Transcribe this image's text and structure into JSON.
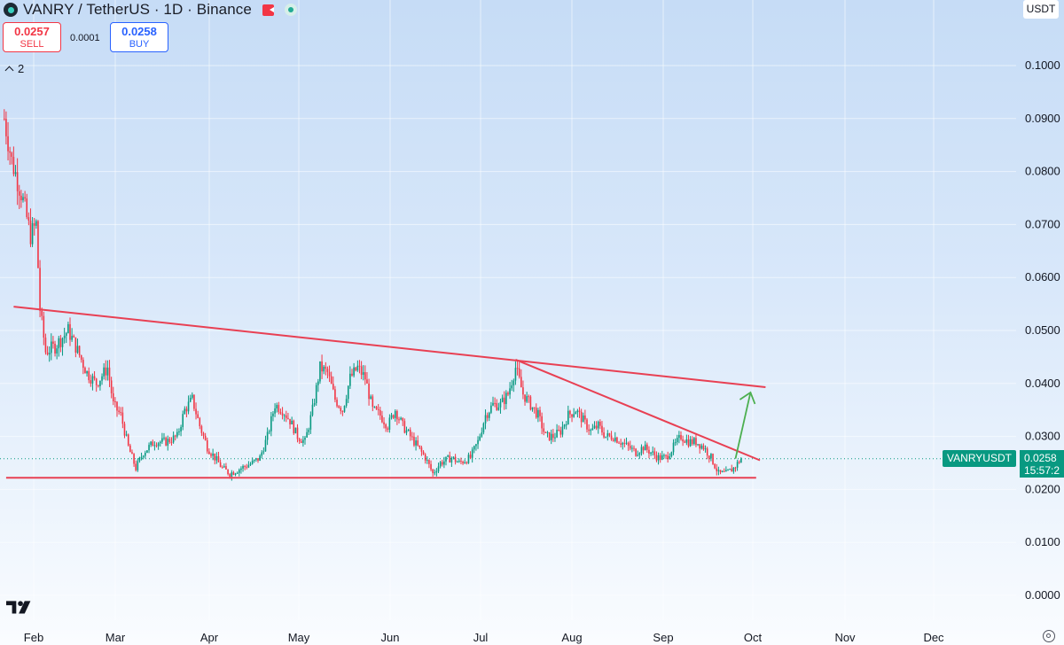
{
  "header": {
    "title": "VANRY / TetherUS · 1D · Binance",
    "sell_price": "0.0257",
    "sell_label": "SELL",
    "buy_price": "0.0258",
    "buy_label": "BUY",
    "spread": "0.0001",
    "indicators_count": "2",
    "icons": [
      "vanry-logo-icon",
      "flag-icon",
      "market-status-icon",
      "chevron-up-icon",
      "tradingview-logo-icon",
      "settings-icon"
    ]
  },
  "price_axis": {
    "currency": "USDT",
    "symbol_tag": "VANRYUSDT",
    "last_price": "0.0258",
    "countdown": "15:57:2"
  },
  "colors": {
    "up": "#089981",
    "down": "#f23645",
    "trendline": "#e84053",
    "arrow": "#4caf50"
  },
  "chart_data": {
    "type": "candlestick",
    "y_ticks": [
      "0.1000",
      "0.0900",
      "0.0800",
      "0.0700",
      "0.0600",
      "0.0500",
      "0.0400",
      "0.0300",
      "0.0200",
      "0.0100",
      "0.0000"
    ],
    "ylim": [
      0.0,
      0.1
    ],
    "x_ticks": [
      "Feb",
      "Mar",
      "Apr",
      "May",
      "Jun",
      "Jul",
      "Aug",
      "Sep",
      "Oct",
      "Nov",
      "Dec"
    ],
    "last_price": 0.0258,
    "price_path": [
      [
        0,
        0.09
      ],
      [
        4,
        0.082
      ],
      [
        9,
        0.076
      ],
      [
        14,
        0.068
      ],
      [
        17,
        0.07
      ],
      [
        19,
        0.054
      ],
      [
        22,
        0.046
      ],
      [
        27,
        0.047
      ],
      [
        34,
        0.05
      ],
      [
        38,
        0.047
      ],
      [
        44,
        0.042
      ],
      [
        49,
        0.04
      ],
      [
        55,
        0.043
      ],
      [
        58,
        0.036
      ],
      [
        62,
        0.034
      ],
      [
        66,
        0.028
      ],
      [
        70,
        0.024
      ],
      [
        74,
        0.027
      ],
      [
        80,
        0.029
      ],
      [
        86,
        0.029
      ],
      [
        92,
        0.03
      ],
      [
        96,
        0.035
      ],
      [
        100,
        0.037
      ],
      [
        104,
        0.032
      ],
      [
        108,
        0.028
      ],
      [
        112,
        0.026
      ],
      [
        116,
        0.024
      ],
      [
        120,
        0.023
      ],
      [
        126,
        0.024
      ],
      [
        132,
        0.025
      ],
      [
        136,
        0.026
      ],
      [
        140,
        0.03
      ],
      [
        144,
        0.036
      ],
      [
        148,
        0.035
      ],
      [
        152,
        0.033
      ],
      [
        156,
        0.03
      ],
      [
        160,
        0.029
      ],
      [
        164,
        0.035
      ],
      [
        168,
        0.043
      ],
      [
        172,
        0.042
      ],
      [
        176,
        0.037
      ],
      [
        180,
        0.035
      ],
      [
        184,
        0.041
      ],
      [
        188,
        0.043
      ],
      [
        192,
        0.041
      ],
      [
        196,
        0.035
      ],
      [
        200,
        0.034
      ],
      [
        204,
        0.032
      ],
      [
        208,
        0.035
      ],
      [
        212,
        0.032
      ],
      [
        216,
        0.03
      ],
      [
        220,
        0.028
      ],
      [
        224,
        0.026
      ],
      [
        228,
        0.023
      ],
      [
        232,
        0.025
      ],
      [
        238,
        0.026
      ],
      [
        242,
        0.025
      ],
      [
        248,
        0.026
      ],
      [
        252,
        0.029
      ],
      [
        256,
        0.034
      ],
      [
        260,
        0.036
      ],
      [
        264,
        0.036
      ],
      [
        268,
        0.038
      ],
      [
        272,
        0.043
      ],
      [
        276,
        0.038
      ],
      [
        280,
        0.036
      ],
      [
        284,
        0.034
      ],
      [
        288,
        0.03
      ],
      [
        292,
        0.03
      ],
      [
        296,
        0.031
      ],
      [
        300,
        0.034
      ],
      [
        304,
        0.035
      ],
      [
        308,
        0.033
      ],
      [
        312,
        0.031
      ],
      [
        316,
        0.032
      ],
      [
        320,
        0.03
      ],
      [
        324,
        0.03
      ],
      [
        328,
        0.029
      ],
      [
        332,
        0.028
      ],
      [
        336,
        0.027
      ],
      [
        340,
        0.028
      ],
      [
        344,
        0.027
      ],
      [
        348,
        0.026
      ],
      [
        352,
        0.026
      ],
      [
        356,
        0.028
      ],
      [
        360,
        0.03
      ],
      [
        364,
        0.029
      ],
      [
        368,
        0.029
      ],
      [
        372,
        0.028
      ],
      [
        376,
        0.026
      ],
      [
        380,
        0.023
      ],
      [
        384,
        0.023
      ],
      [
        388,
        0.024
      ],
      [
        392,
        0.0258
      ]
    ],
    "annotations": {
      "upper_trendline": [
        [
          5,
          0.0545
        ],
        [
          405,
          0.0393
        ]
      ],
      "inner_trendline": [
        [
          272,
          0.0445
        ],
        [
          402,
          0.0255
        ]
      ],
      "support_line": [
        [
          1,
          0.0222
        ],
        [
          400,
          0.0222
        ]
      ],
      "breakout_arrow": [
        [
          389,
          0.0258
        ],
        [
          397,
          0.0383
        ]
      ]
    },
    "grid": true
  }
}
